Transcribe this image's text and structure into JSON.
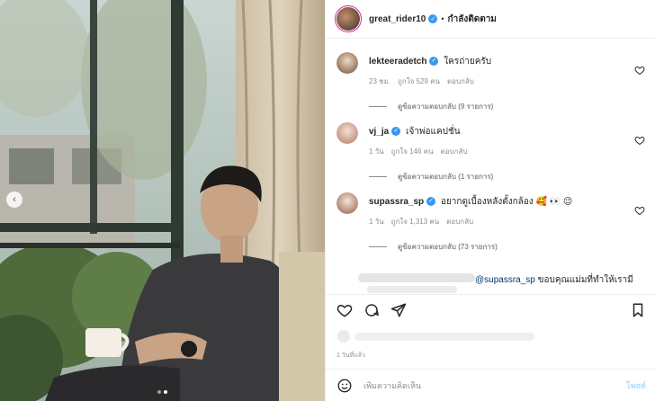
{
  "header": {
    "username": "great_rider10",
    "separator": "•",
    "follow_label": "กำลังติดตาม"
  },
  "comments": [
    {
      "username": "lekteeradetch",
      "text": "ใครถ่ายครับ",
      "time": "23 ชม.",
      "likes": "ถูกใจ 529 คน",
      "reply": "ตอบกลับ",
      "view_replies": "ดูข้อความตอบกลับ (9 รายการ)"
    },
    {
      "username": "vj_ja",
      "text": "เจ้าพ่อแคปชั่น",
      "time": "1 วัน",
      "likes": "ถูกใจ 146 คน",
      "reply": "ตอบกลับ",
      "view_replies": "ดูข้อความตอบกลับ (1 รายการ)"
    },
    {
      "username": "supassra_sp",
      "text": "อยากดูเบื้องหลังตั้งกล้อง 🥰 👀 😉",
      "time": "1 วัน",
      "likes": "ถูกใจ 1,313 คน",
      "reply": "ตอบกลับ",
      "view_replies": "ดูข้อความตอบกลับ (73 รายการ)"
    }
  ],
  "partial_reply": {
    "mention": "@supassra_sp",
    "text": " ขอบคุณแม่มที่ทำให้เรามี"
  },
  "footer": {
    "time_ago": "1 วันที่แล้ว",
    "comment_placeholder": "เพิ่มความคิดเห็น",
    "post_label": "โพสต์"
  },
  "icons": {
    "prev": "chevron-left-icon",
    "heart": "heart-icon",
    "comment": "comment-icon",
    "share": "send-icon",
    "save": "bookmark-icon",
    "emoji": "emoji-icon"
  },
  "colors": {
    "verified": "#3897f0",
    "link": "#00376b",
    "muted": "#8e8e8e",
    "post_button": "#b2dffc"
  }
}
